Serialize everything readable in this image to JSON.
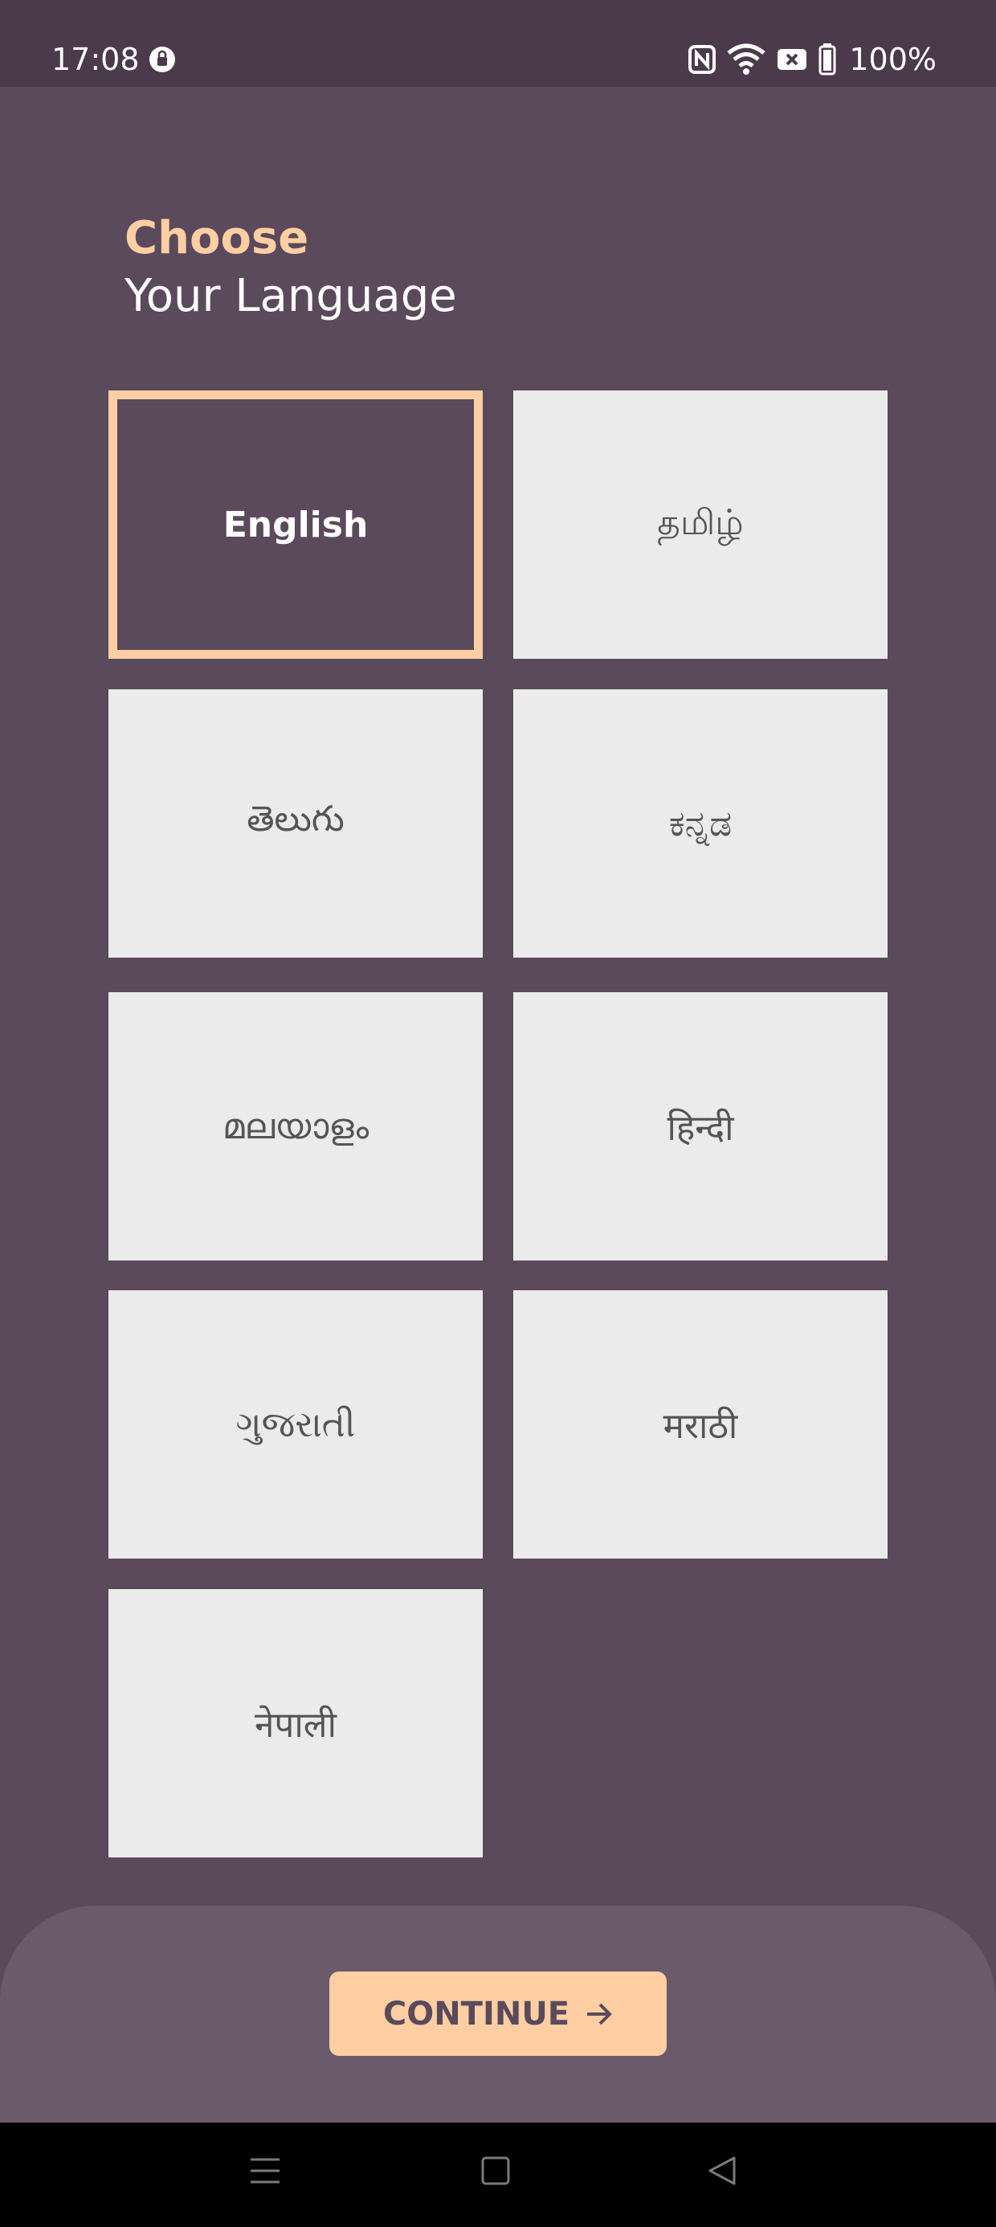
{
  "status_bar": {
    "time": "17:08",
    "battery": "100%"
  },
  "heading": {
    "line1": "Choose",
    "line2": "Your Language"
  },
  "languages": [
    {
      "label": "English",
      "selected": true
    },
    {
      "label": "தமிழ்",
      "selected": false
    },
    {
      "label": "తెలుగు",
      "selected": false
    },
    {
      "label": "ಕನ್ನಡ",
      "selected": false
    },
    {
      "label": "മലയാളം",
      "selected": false
    },
    {
      "label": "हिन्दी",
      "selected": false
    },
    {
      "label": "ગુજરાતી",
      "selected": false
    },
    {
      "label": "मराठी",
      "selected": false
    },
    {
      "label": "नेपाली",
      "selected": false
    }
  ],
  "continue_button": {
    "label": "CONTINUE",
    "icon": "arrow-right-icon"
  },
  "colors": {
    "background": "#5b4a5b",
    "accent": "#ffcfa3",
    "tile": "#ebebeb",
    "panel": "#6a5a6b"
  }
}
